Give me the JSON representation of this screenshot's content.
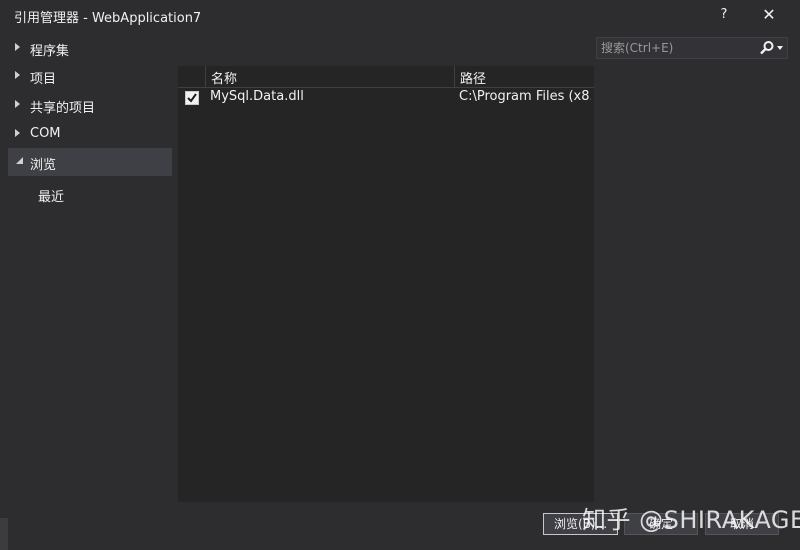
{
  "window": {
    "title": "引用管理器 - WebApplication7",
    "help_label": "?",
    "close_label": "✕"
  },
  "sidebar": {
    "items": [
      {
        "label": "程序集",
        "state": "collapsed"
      },
      {
        "label": "项目",
        "state": "collapsed"
      },
      {
        "label": "共享的项目",
        "state": "collapsed"
      },
      {
        "label": "COM",
        "state": "collapsed"
      },
      {
        "label": "浏览",
        "state": "expanded",
        "selected": true
      }
    ],
    "sub_items": [
      {
        "label": "最近"
      }
    ]
  },
  "search": {
    "placeholder": "搜索(Ctrl+E)",
    "value": ""
  },
  "table": {
    "columns": [
      "名称",
      "路径"
    ],
    "rows": [
      {
        "checked": true,
        "name": "MySql.Data.dll",
        "path": "C:\\Program Files (x8..."
      }
    ]
  },
  "buttons": {
    "browse": "浏览(B)...",
    "ok": "确定",
    "cancel": "取消"
  },
  "watermark": "知乎 @SHIRAKAGE",
  "colors": {
    "background": "#2d2d30",
    "panel": "#252526",
    "selected": "#3f3f46",
    "text": "#f1f1f1"
  }
}
